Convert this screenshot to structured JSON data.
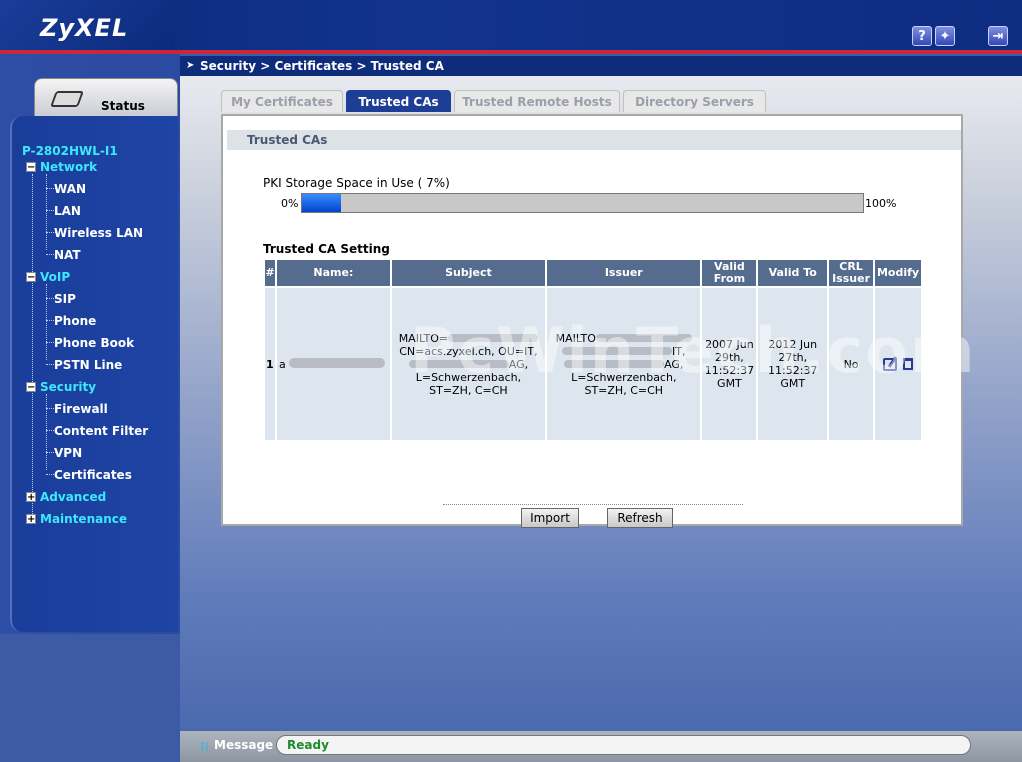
{
  "header": {
    "logo": "ZyXEL",
    "help_icon": "question-icon",
    "wizard_icon": "wizard-icon",
    "logout_icon": "logout-icon"
  },
  "breadcrumb": "Security > Certificates > Trusted CA",
  "sidebar": {
    "status_label": "Status",
    "device": "P-2802HWL-I1",
    "groups": [
      {
        "label": "Network",
        "expanded": true,
        "items": [
          "WAN",
          "LAN",
          "Wireless LAN",
          "NAT"
        ]
      },
      {
        "label": "VoIP",
        "expanded": true,
        "items": [
          "SIP",
          "Phone",
          "Phone Book",
          "PSTN Line"
        ]
      },
      {
        "label": "Security",
        "expanded": true,
        "items": [
          "Firewall",
          "Content Filter",
          "VPN",
          "Certificates"
        ]
      },
      {
        "label": "Advanced",
        "expanded": false,
        "items": []
      },
      {
        "label": "Maintenance",
        "expanded": false,
        "items": []
      }
    ]
  },
  "tabs": [
    {
      "label": "My Certificates",
      "active": false
    },
    {
      "label": "Trusted CAs",
      "active": true
    },
    {
      "label": "Trusted Remote Hosts",
      "active": false
    },
    {
      "label": "Directory Servers",
      "active": false
    }
  ],
  "panel": {
    "title": "Trusted CAs",
    "pki_label": "PKI Storage Space in Use ( 7%)",
    "pki_percent": 7,
    "pki_min": "0%",
    "pki_max": "100%",
    "setting_title": "Trusted CA Setting"
  },
  "table": {
    "headers": [
      "#",
      "Name:",
      "Subject",
      "Issuer",
      "Valid From",
      "Valid To",
      "CRL Issuer",
      "Modify"
    ],
    "row": {
      "index": "1",
      "name": "a",
      "subject_l1": "MAILTO=",
      "subject_l2": "CN=acs.zyxel.ch, OU=IT,",
      "subject_l3": "AG,",
      "subject_l4": "L=Schwerzenbach,",
      "subject_l5": "ST=ZH, C=CH",
      "issuer_l1": "MAILTO",
      "issuer_l2": "IT,",
      "issuer_l3": "AG,",
      "issuer_l4": "L=Schwerzenbach,",
      "issuer_l5": "ST=ZH, C=CH",
      "valid_from": "2007 Jun 29th, 11:52:37 GMT",
      "valid_to": "2012 Jun 27th, 11:52:37 GMT",
      "crl_issuer": "No",
      "edit_icon": "edit-icon",
      "delete_icon": "trash-icon"
    }
  },
  "buttons": {
    "import": "Import",
    "refresh": "Refresh"
  },
  "message": {
    "label": "Message",
    "value": "Ready"
  },
  "watermark": "PcWinTech.com"
}
